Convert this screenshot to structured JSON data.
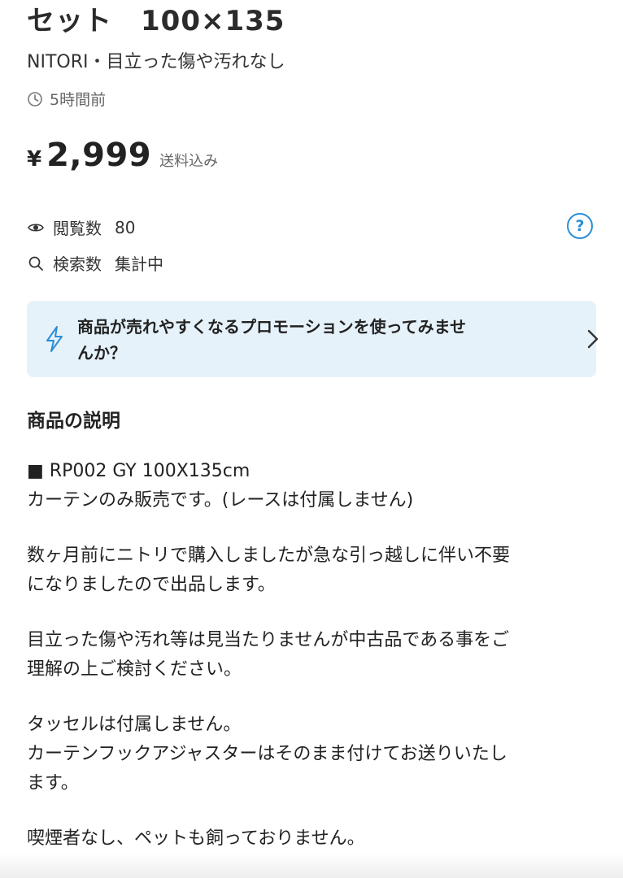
{
  "item": {
    "title_tail": "セット　100×135",
    "subtitle": "NITORI・目立った傷や汚れなし",
    "posted": "5時間前",
    "currency": "¥",
    "price": "2,999",
    "shipping": "送料込み"
  },
  "stats": {
    "views_label": "閲覧数",
    "views_value": "80",
    "search_label": "検索数",
    "search_value": "集計中",
    "help": "?"
  },
  "promo": {
    "line1": "商品が売れやすくなるプロモーションを使ってみませ",
    "line2": "んか？"
  },
  "description": {
    "heading": "商品の説明",
    "lines": [
      "■ RP002 GY 100X135cm",
      "カーテンのみ販売です。(レースは付属しません)",
      "",
      "数ヶ月前にニトリで購入しましたが急な引っ越しに伴い不要",
      "になりましたので出品します。",
      "",
      "目立った傷や汚れ等は見当たりませんが中古品である事をご",
      "理解の上ご検討ください。",
      "",
      "タッセルは付属しません。",
      "カーテンフックアジャスターはそのまま付けてお送りいたし",
      "ます。",
      "",
      "喫煙者なし、ペットも飼っておりません。"
    ]
  },
  "colors": {
    "accent": "#2a8fd6",
    "promo_bg": "#e6f2fa",
    "text": "#222222",
    "muted": "#666666"
  },
  "icons": [
    "clock-icon",
    "eye-icon",
    "search-icon",
    "help-icon",
    "lightning-icon",
    "chevron-right-icon"
  ]
}
